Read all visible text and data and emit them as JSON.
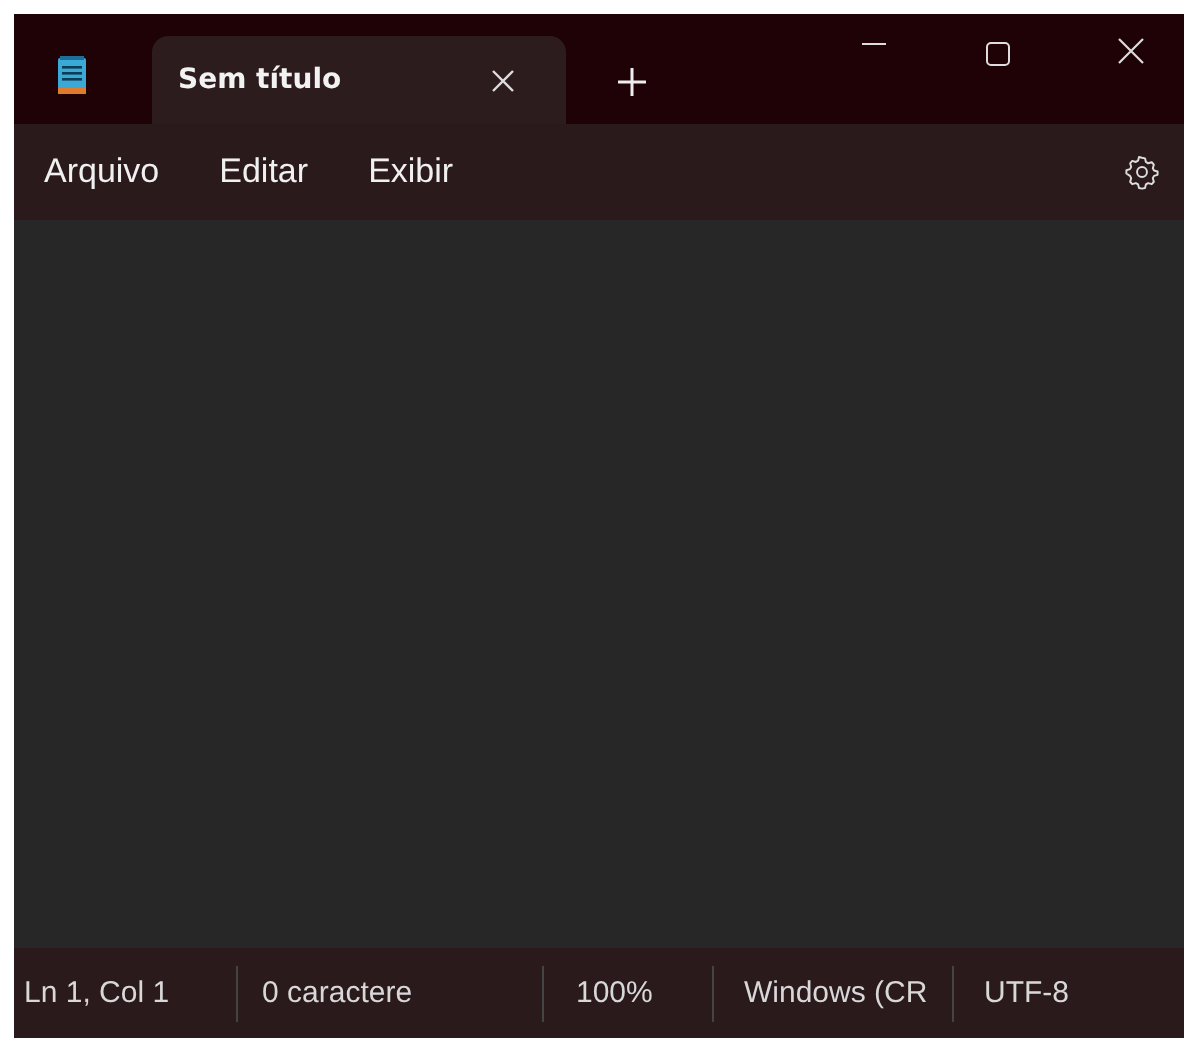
{
  "tabs": [
    {
      "label": "Sem título",
      "selected": true
    }
  ],
  "menu": [
    "Arquivo",
    "Editar",
    "Exibir"
  ],
  "status_bar": [
    "Ln 1, Col 1",
    "0 caractere",
    "100%",
    "Windows (CR",
    "UTF-8"
  ]
}
